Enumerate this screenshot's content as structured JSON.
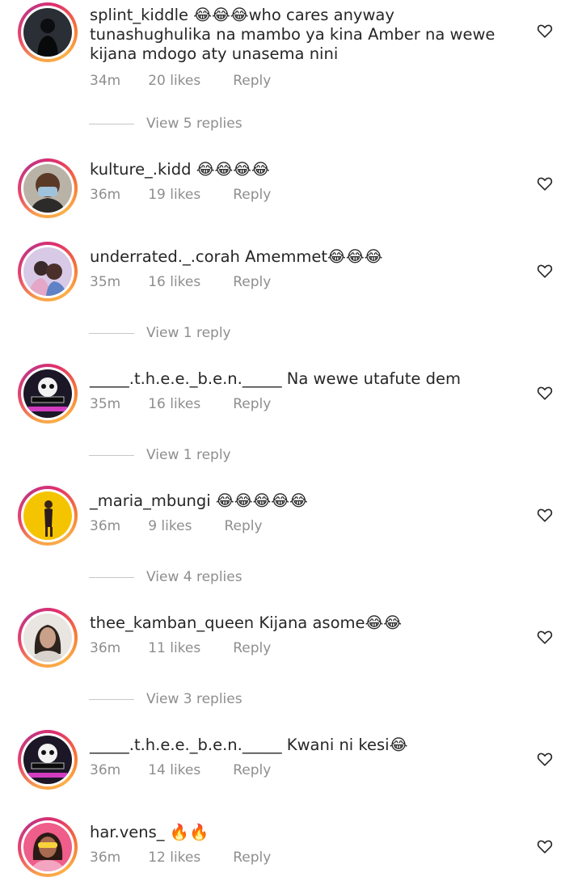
{
  "comments": [
    {
      "username": "splint_kiddle",
      "text": "😂😂😂who cares anyway tunashughulika na mambo ya kina Amber na wewe kijana mdogo aty unasema nini",
      "time": "34m",
      "likes": "20 likes",
      "reply": "Reply",
      "view_replies": "View 5 replies"
    },
    {
      "username": "kulture_.kidd",
      "text": "😂😂😂😂",
      "time": "36m",
      "likes": "19 likes",
      "reply": "Reply"
    },
    {
      "username": "underrated._.corah",
      "text": "Amemmet😂😂😂",
      "time": "35m",
      "likes": "16 likes",
      "reply": "Reply",
      "view_replies": "View 1 reply"
    },
    {
      "username": "_____.t.h.e.e._b.e.n._____",
      "text": "Na wewe utafute dem",
      "time": "35m",
      "likes": "16 likes",
      "reply": "Reply",
      "view_replies": "View 1 reply"
    },
    {
      "username": "_maria_mbungi",
      "text": "😂😂😂😂😂",
      "time": "36m",
      "likes": "9 likes",
      "reply": "Reply",
      "view_replies": "View 4 replies"
    },
    {
      "username": "thee_kamban_queen",
      "text": "Kijana asome😂😂",
      "time": "36m",
      "likes": "11 likes",
      "reply": "Reply",
      "view_replies": "View 3 replies"
    },
    {
      "username": "_____.t.h.e.e._b.e.n._____",
      "text": "Kwani ni kesi😂",
      "time": "36m",
      "likes": "14 likes",
      "reply": "Reply"
    },
    {
      "username": "har.vens_",
      "text": "🔥🔥",
      "time": "36m",
      "likes": "12 likes",
      "reply": "Reply"
    }
  ],
  "icons": {
    "like": "heart-outline-icon"
  },
  "colors": {
    "text": "#262626",
    "secondary": "#8e8e8e",
    "divider": "#c7c7c7"
  }
}
